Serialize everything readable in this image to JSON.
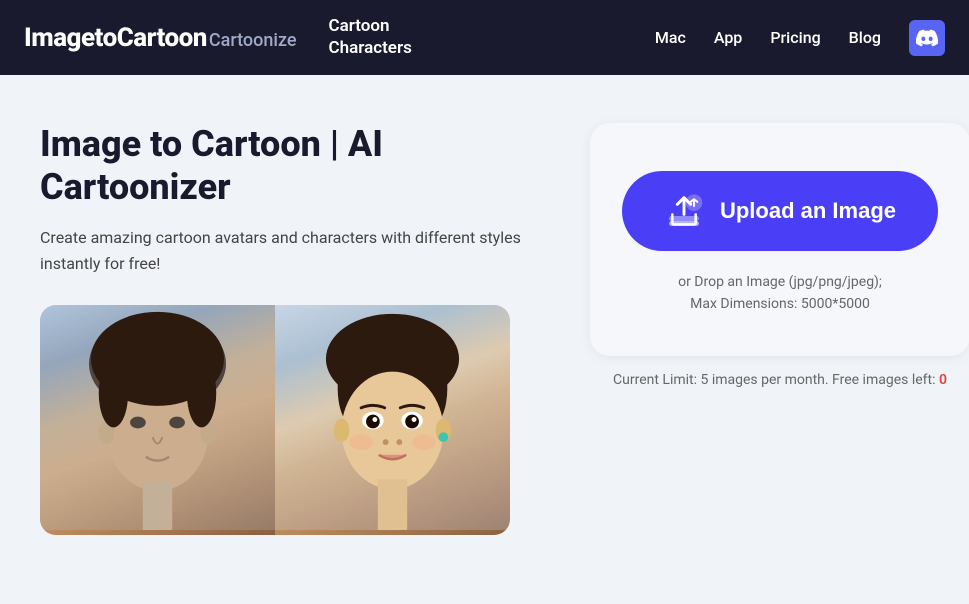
{
  "nav": {
    "brand_main": "ImagetoCartoon",
    "brand_sub": "Cartoonize",
    "cartoon_line1": "Cartoon",
    "cartoon_line2": "Characters",
    "links": [
      {
        "label": "Mac",
        "id": "mac"
      },
      {
        "label": "App",
        "id": "app"
      },
      {
        "label": "Pricing",
        "id": "pricing"
      },
      {
        "label": "Blog",
        "id": "blog"
      }
    ]
  },
  "hero": {
    "title": "Image to Cartoon | AI Cartoonizer",
    "subtitle": "Create amazing cartoon avatars and characters with different styles instantly for free!"
  },
  "upload": {
    "button_label": "Upload an Image",
    "drop_hint_line1": "or Drop an Image (jpg/png/jpeg);",
    "drop_hint_line2": "Max Dimensions: 5000*5000",
    "limit_text": "Current Limit: 5 images per month. Free images left:",
    "limit_number": "0"
  }
}
